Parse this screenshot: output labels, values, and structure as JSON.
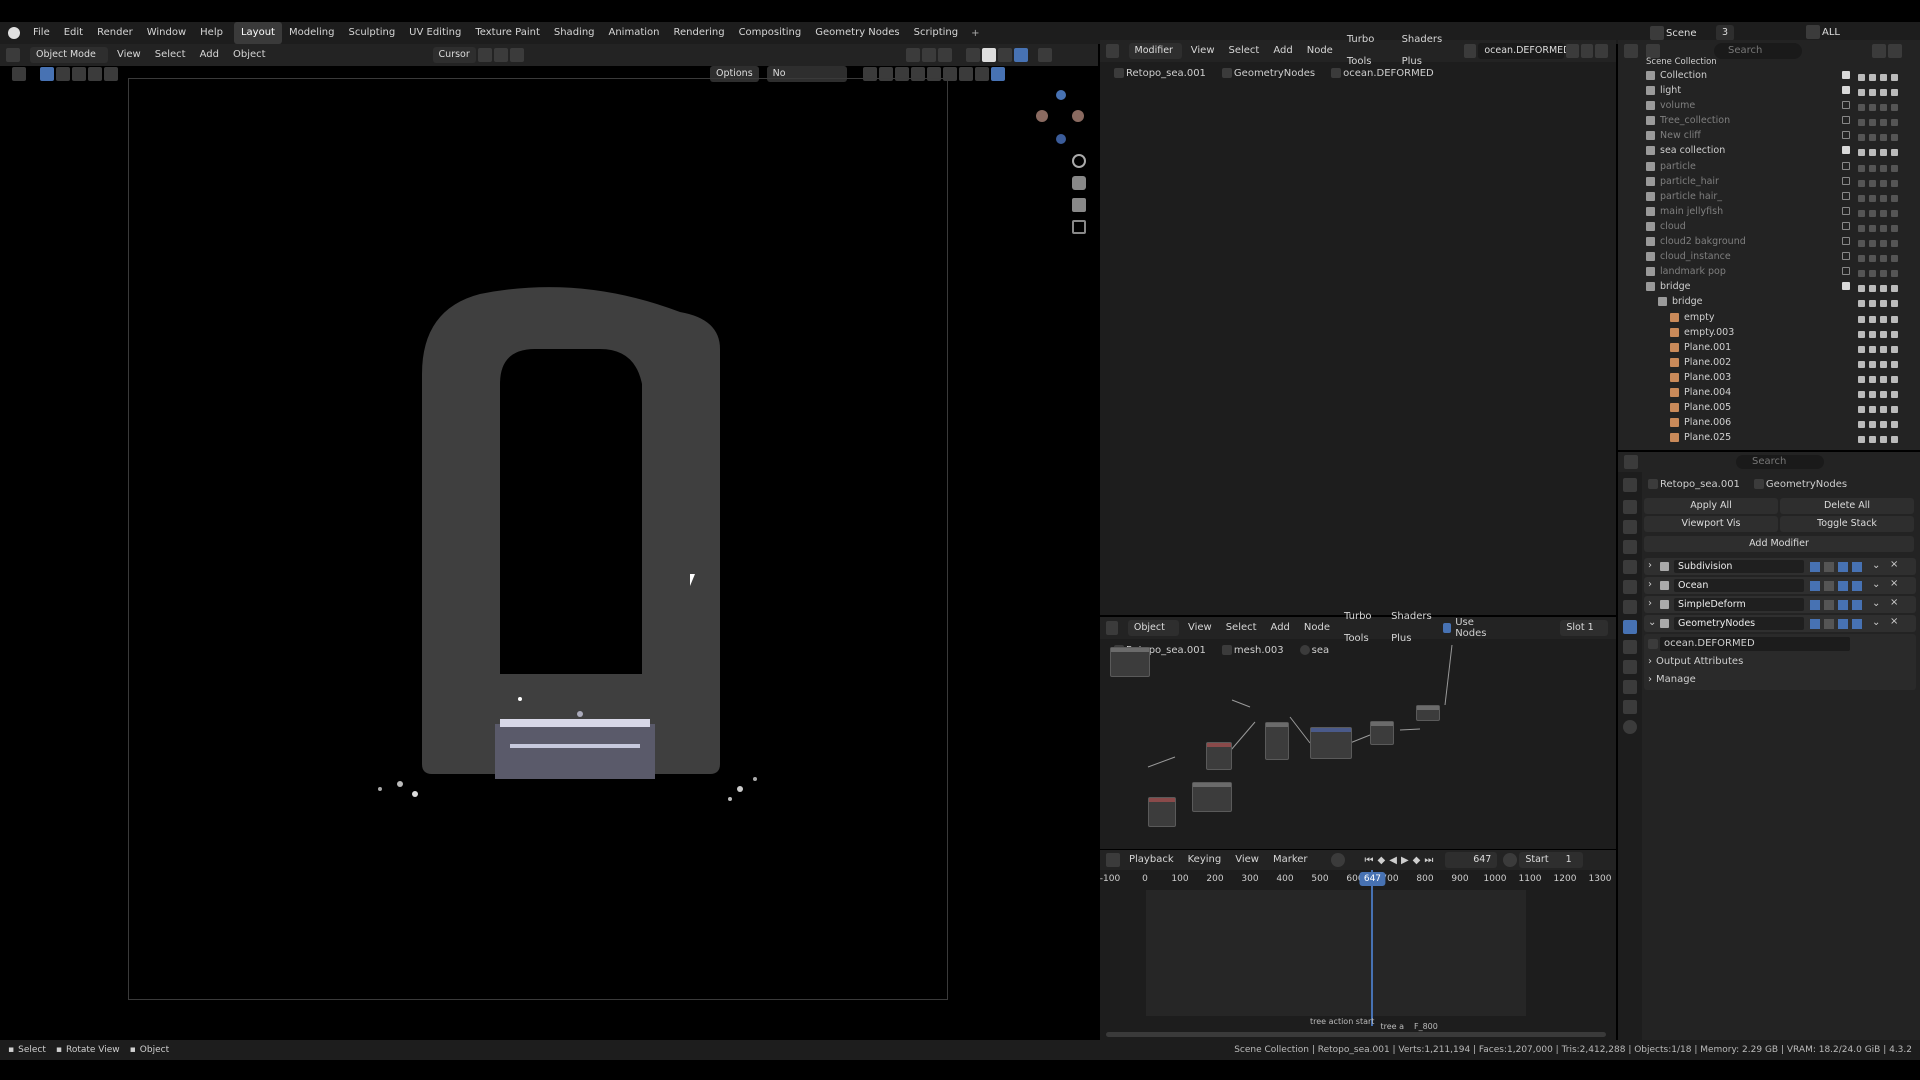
{
  "menubar": {
    "menus": [
      "File",
      "Edit",
      "Render",
      "Window",
      "Help"
    ],
    "workspaces": [
      "Layout",
      "Modeling",
      "Sculpting",
      "UV Editing",
      "Texture Paint",
      "Shading",
      "Animation",
      "Rendering",
      "Compositing",
      "Geometry Nodes",
      "Scripting"
    ],
    "active_workspace": "Layout",
    "scene": "Scene",
    "view_layer": "ALL",
    "scene_users": "3"
  },
  "viewport": {
    "mode": "Object Mode",
    "menus": [
      "View",
      "Select",
      "Add",
      "Object"
    ],
    "transform_orientation": "Cursor",
    "options_label": "Options",
    "dropdown_label": "No Dropdowns"
  },
  "node_editor_top": {
    "editor_type": "Modifier",
    "menus": [
      "View",
      "Select",
      "Add",
      "Node",
      "Turbo Tools",
      "Shaders Plus"
    ],
    "node_group": "ocean.DEFORMED",
    "breadcrumb": [
      "Retopo_sea.001",
      "GeometryNodes",
      "ocean.DEFORMED"
    ]
  },
  "node_editor_bottom": {
    "editor_type": "Object",
    "menus": [
      "View",
      "Select",
      "Add",
      "Node",
      "Turbo Tools",
      "Shaders Plus"
    ],
    "use_nodes_label": "Use Nodes",
    "slot": "Slot 1",
    "breadcrumb": [
      "Retopo_sea.001",
      "mesh.003",
      "sea"
    ]
  },
  "timeline": {
    "menus": [
      "Playback",
      "Keying",
      "View",
      "Marker"
    ],
    "current_frame": "647",
    "start_label": "Start",
    "start_value": "1",
    "ticks": [
      "-100",
      "0",
      "100",
      "200",
      "300",
      "400",
      "500",
      "600",
      "700",
      "800",
      "900",
      "1000",
      "1100",
      "1200",
      "1300"
    ],
    "markers": [
      "tree action start",
      "tree a",
      "F_800"
    ]
  },
  "outliner": {
    "search_placeholder": "Search",
    "root": "Scene Collection",
    "items": [
      {
        "label": "Collection",
        "dim": false,
        "checked": true,
        "indent": 0
      },
      {
        "label": "light",
        "dim": false,
        "checked": true,
        "indent": 0
      },
      {
        "label": "volume",
        "dim": true,
        "checked": false,
        "indent": 0
      },
      {
        "label": "Tree_collection",
        "dim": true,
        "checked": false,
        "indent": 0
      },
      {
        "label": "New cliff",
        "dim": true,
        "checked": false,
        "indent": 0
      },
      {
        "label": "sea collection",
        "dim": false,
        "checked": true,
        "indent": 0
      },
      {
        "label": "particle",
        "dim": true,
        "checked": false,
        "indent": 0
      },
      {
        "label": "particle_hair",
        "dim": true,
        "checked": false,
        "indent": 0
      },
      {
        "label": "particle hair_",
        "dim": true,
        "checked": false,
        "indent": 0
      },
      {
        "label": "main jellyfish",
        "dim": true,
        "checked": false,
        "indent": 0
      },
      {
        "label": "cloud",
        "dim": true,
        "checked": false,
        "indent": 0
      },
      {
        "label": "cloud2 bakground",
        "dim": true,
        "checked": false,
        "indent": 0
      },
      {
        "label": "cloud_instance",
        "dim": true,
        "checked": false,
        "indent": 0
      },
      {
        "label": "landmark pop",
        "dim": true,
        "checked": false,
        "indent": 0
      },
      {
        "label": "bridge",
        "dim": false,
        "checked": true,
        "indent": 0
      },
      {
        "label": "bridge",
        "dim": false,
        "checked": null,
        "indent": 1
      },
      {
        "label": "empty",
        "dim": false,
        "checked": null,
        "indent": 2
      },
      {
        "label": "empty.003",
        "dim": false,
        "checked": null,
        "indent": 2
      },
      {
        "label": "Plane.001",
        "dim": false,
        "checked": null,
        "indent": 2
      },
      {
        "label": "Plane.002",
        "dim": false,
        "checked": null,
        "indent": 2
      },
      {
        "label": "Plane.003",
        "dim": false,
        "checked": null,
        "indent": 2
      },
      {
        "label": "Plane.004",
        "dim": false,
        "checked": null,
        "indent": 2
      },
      {
        "label": "Plane.005",
        "dim": false,
        "checked": null,
        "indent": 2
      },
      {
        "label": "Plane.006",
        "dim": false,
        "checked": null,
        "indent": 2
      },
      {
        "label": "Plane.025",
        "dim": false,
        "checked": null,
        "indent": 2
      }
    ]
  },
  "properties": {
    "search_placeholder": "Search",
    "breadcrumb": [
      "Retopo_sea.001",
      "GeometryNodes"
    ],
    "apply_all": "Apply All",
    "delete_all": "Delete All",
    "viewport_vis": "Viewport Vis",
    "toggle_stack": "Toggle Stack",
    "add_modifier": "Add Modifier",
    "modifiers": [
      "Subdivision",
      "Ocean",
      "SimpleDeform",
      "GeometryNodes"
    ],
    "node_group": "ocean.DEFORMED",
    "panels": [
      "Output Attributes",
      "Manage"
    ]
  },
  "statusbar": {
    "left": [
      "Select",
      "Rotate View",
      "Object"
    ],
    "info": "Scene Collection | Retopo_sea.001 | Verts:1,211,194 | Faces:1,207,000 | Tris:2,412,288 | Objects:1/18 | Memory: 2.29 GB | VRAM: 18.2/24.0 GiB | 4.3.2"
  },
  "colors": {
    "accent": "#4772b3",
    "header": "#232323",
    "panel": "#2b2b2b",
    "frame_line": "#4772b3"
  }
}
